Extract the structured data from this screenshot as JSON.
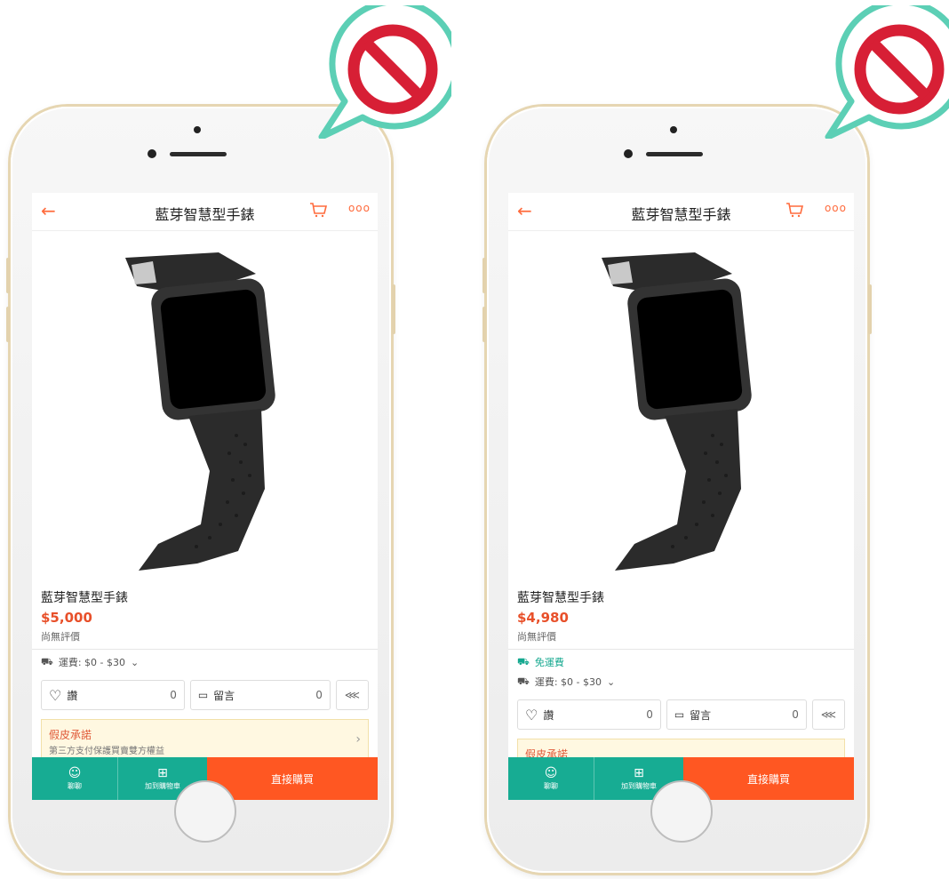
{
  "colors": {
    "accent": "#ff6b3d",
    "price": "#e8502a",
    "teal": "#17ac93",
    "buy": "#ff5722",
    "prohibit_red": "#d71f35",
    "bubble_teal": "#5ccfb5"
  },
  "phones": [
    {
      "nav": {
        "title": "藍芽智慧型手錶",
        "back_icon": "arrow-left",
        "cart_icon": "cart",
        "more_icon": "ooo"
      },
      "product": {
        "name": "藍芽智慧型手錶",
        "price": "$5,000",
        "rating": "尚無評價"
      },
      "free_shipping": "",
      "shipping": "運費: $0 - $30",
      "like": {
        "label": "讚",
        "count": "0"
      },
      "comment": {
        "label": "留言",
        "count": "0"
      },
      "promise": {
        "label": "假皮承諾",
        "sub": "第三方支付保護買賣雙方權益"
      },
      "bottom": {
        "chat": "聊聊",
        "add_cart": "加到購物車",
        "buy": "直接購買"
      }
    },
    {
      "nav": {
        "title": "藍芽智慧型手錶",
        "back_icon": "arrow-left",
        "cart_icon": "cart",
        "more_icon": "ooo"
      },
      "product": {
        "name": "藍芽智慧型手錶",
        "price": "$4,980",
        "rating": "尚無評價"
      },
      "free_shipping": "免運費",
      "shipping": "運費: $0 - $30",
      "like": {
        "label": "讚",
        "count": "0"
      },
      "comment": {
        "label": "留言",
        "count": "0"
      },
      "promise": {
        "label": "假皮承諾",
        "sub": ""
      },
      "bottom": {
        "chat": "聊聊",
        "add_cart": "加到購物車",
        "buy": "直接購買"
      }
    }
  ]
}
